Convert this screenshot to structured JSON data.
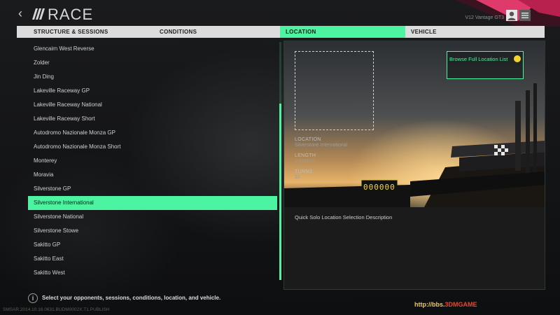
{
  "header": {
    "title": "RACE",
    "car_label": "V12 Vantage GT3",
    "icons": {
      "back": "back-chevron-icon",
      "logo": "stripes-logo-icon",
      "profile": "profile-icon",
      "menu": "menu-icon"
    }
  },
  "tabs": [
    {
      "label": "STRUCTURE & SESSIONS",
      "active": false
    },
    {
      "label": "CONDITIONS",
      "active": false
    },
    {
      "label": "LOCATION",
      "active": true
    },
    {
      "label": "VEHICLE",
      "active": false
    }
  ],
  "locations": {
    "items": [
      "Glencairn West Reverse",
      "Zolder",
      "Jin Ding",
      "Lakeville Raceway GP",
      "Lakeville Raceway National",
      "Lakeville Raceway Short",
      "Autodromo Nazionale Monza GP",
      "Autodromo Nazionale Monza Short",
      "Monterey",
      "Moravia",
      "Silverstone GP",
      "Silverstone International",
      "Silverstone National",
      "Silverstone Stowe",
      "Sakitto GP",
      "Sakitto East",
      "Sakitto West"
    ],
    "selected": "Silverstone International"
  },
  "detail": {
    "browse_label": "Browse Full Location List",
    "location_key": "LOCATION",
    "location_value": "Silverstone International",
    "length_key": "LENGTH",
    "length_value": "3.619KM",
    "turns_key": "TURNS",
    "turns_value": "10",
    "description": "Quick Solo Location Selection Description",
    "board_readout": "000000"
  },
  "footer": {
    "hint": "Select your opponents, sessions, conditions, location, and vehicle.",
    "build": "SMSAR.2014.10.16.0631.BUDM0002X.T1.PUBLISH",
    "watermark_a": "http://bbs.",
    "watermark_b": "3DMGAME"
  },
  "colors": {
    "accent": "#4cf3a0",
    "browse_dot": "#f2d233",
    "header_pink": "#e03a6a"
  }
}
